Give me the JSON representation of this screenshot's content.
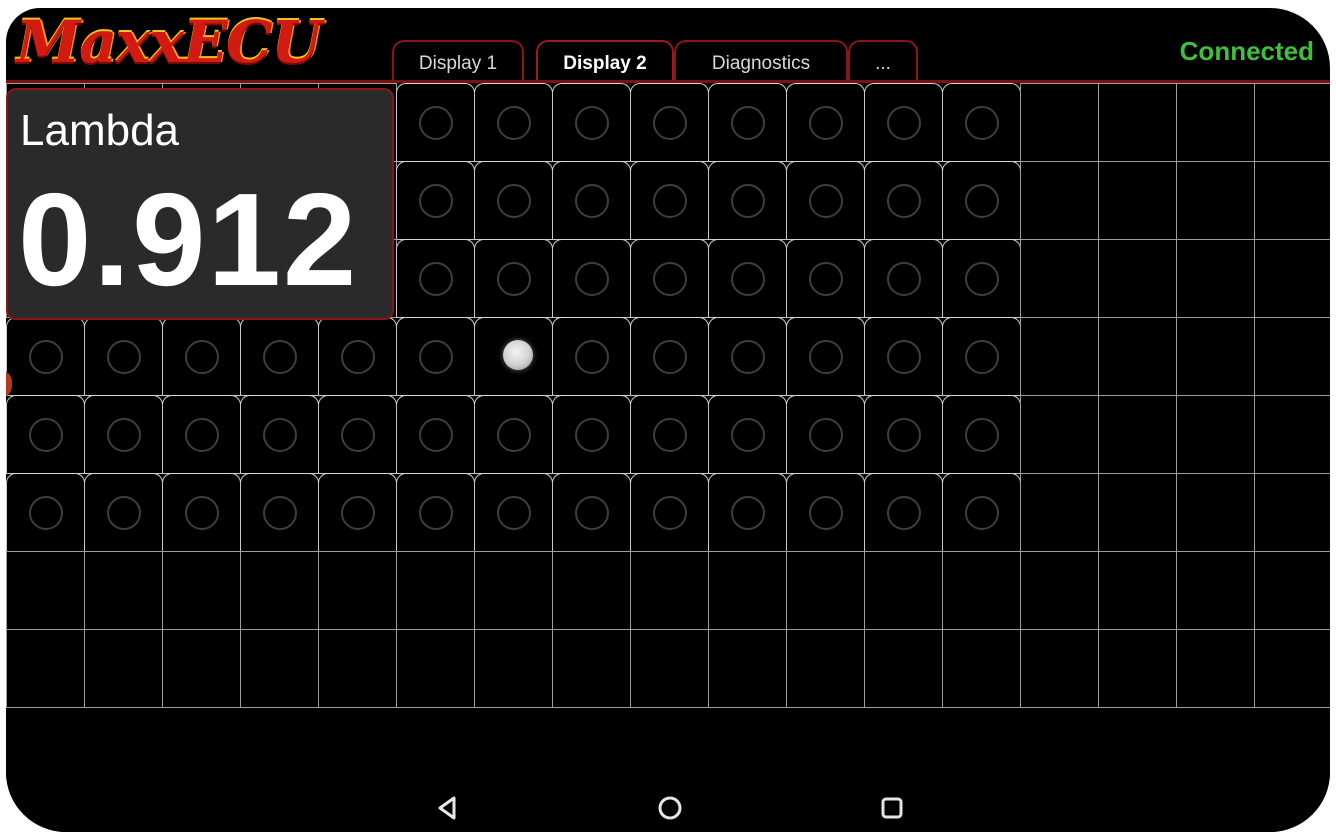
{
  "app": {
    "logo": "MaxxECU"
  },
  "tabs": [
    {
      "label": "Display 1",
      "active": false
    },
    {
      "label": "Display 2",
      "active": true
    },
    {
      "label": "Diagnostics",
      "active": false
    },
    {
      "label": "...",
      "active": false
    }
  ],
  "status": {
    "text": "Connected",
    "color": "#3fbf3a"
  },
  "gauge": {
    "label": "Lambda",
    "value": "0.912"
  },
  "navbar": {
    "back": "back-icon",
    "home": "home-icon",
    "recents": "recents-icon"
  },
  "colors": {
    "accent": "#8a1518",
    "background": "#000000",
    "panel": "#2a2a2a"
  }
}
